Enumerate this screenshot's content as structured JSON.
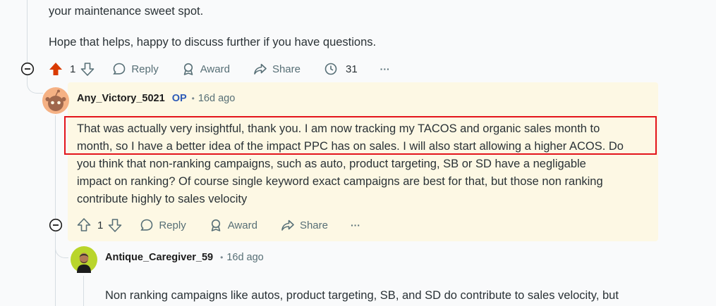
{
  "comment1": {
    "text_line1": "your maintenance sweet spot.",
    "text_line2": "Hope that helps, happy to discuss further if you have questions.",
    "votes": "1",
    "reply_label": "Reply",
    "award_label": "Award",
    "share_label": "Share",
    "views": "31",
    "more": "···"
  },
  "op_comment": {
    "username": "Any_Victory_5021",
    "op_badge": "OP",
    "sep": "•",
    "time": "16d ago",
    "lines": [
      "That was actually very insightful, thank you. I am now tracking my TACOS and organic sales month to",
      "month, so I have a better idea of the impact PPC has on sales. I will also start allowing a higher ACOS. Do",
      "you think that non-ranking campaigns, such as auto, product targeting, SB or SD have a negligable",
      "impact on ranking? Of course single keyword exact campaigns are best for that, but those non ranking",
      "contribute highly to sales velocity"
    ],
    "votes": "1",
    "reply_label": "Reply",
    "award_label": "Award",
    "share_label": "Share",
    "more": "···"
  },
  "reply_comment": {
    "username": "Antique_Caregiver_59",
    "sep": "•",
    "time": "16d ago",
    "text_line1": "Non ranking campaigns like autos, product targeting, SB, and SD do contribute to sales velocity, but"
  },
  "colors": {
    "upvote_active": "#d93a00",
    "highlight_border": "#e3141b",
    "op_background": "#fdf8e4",
    "op_badge": "#2e5bb7"
  }
}
